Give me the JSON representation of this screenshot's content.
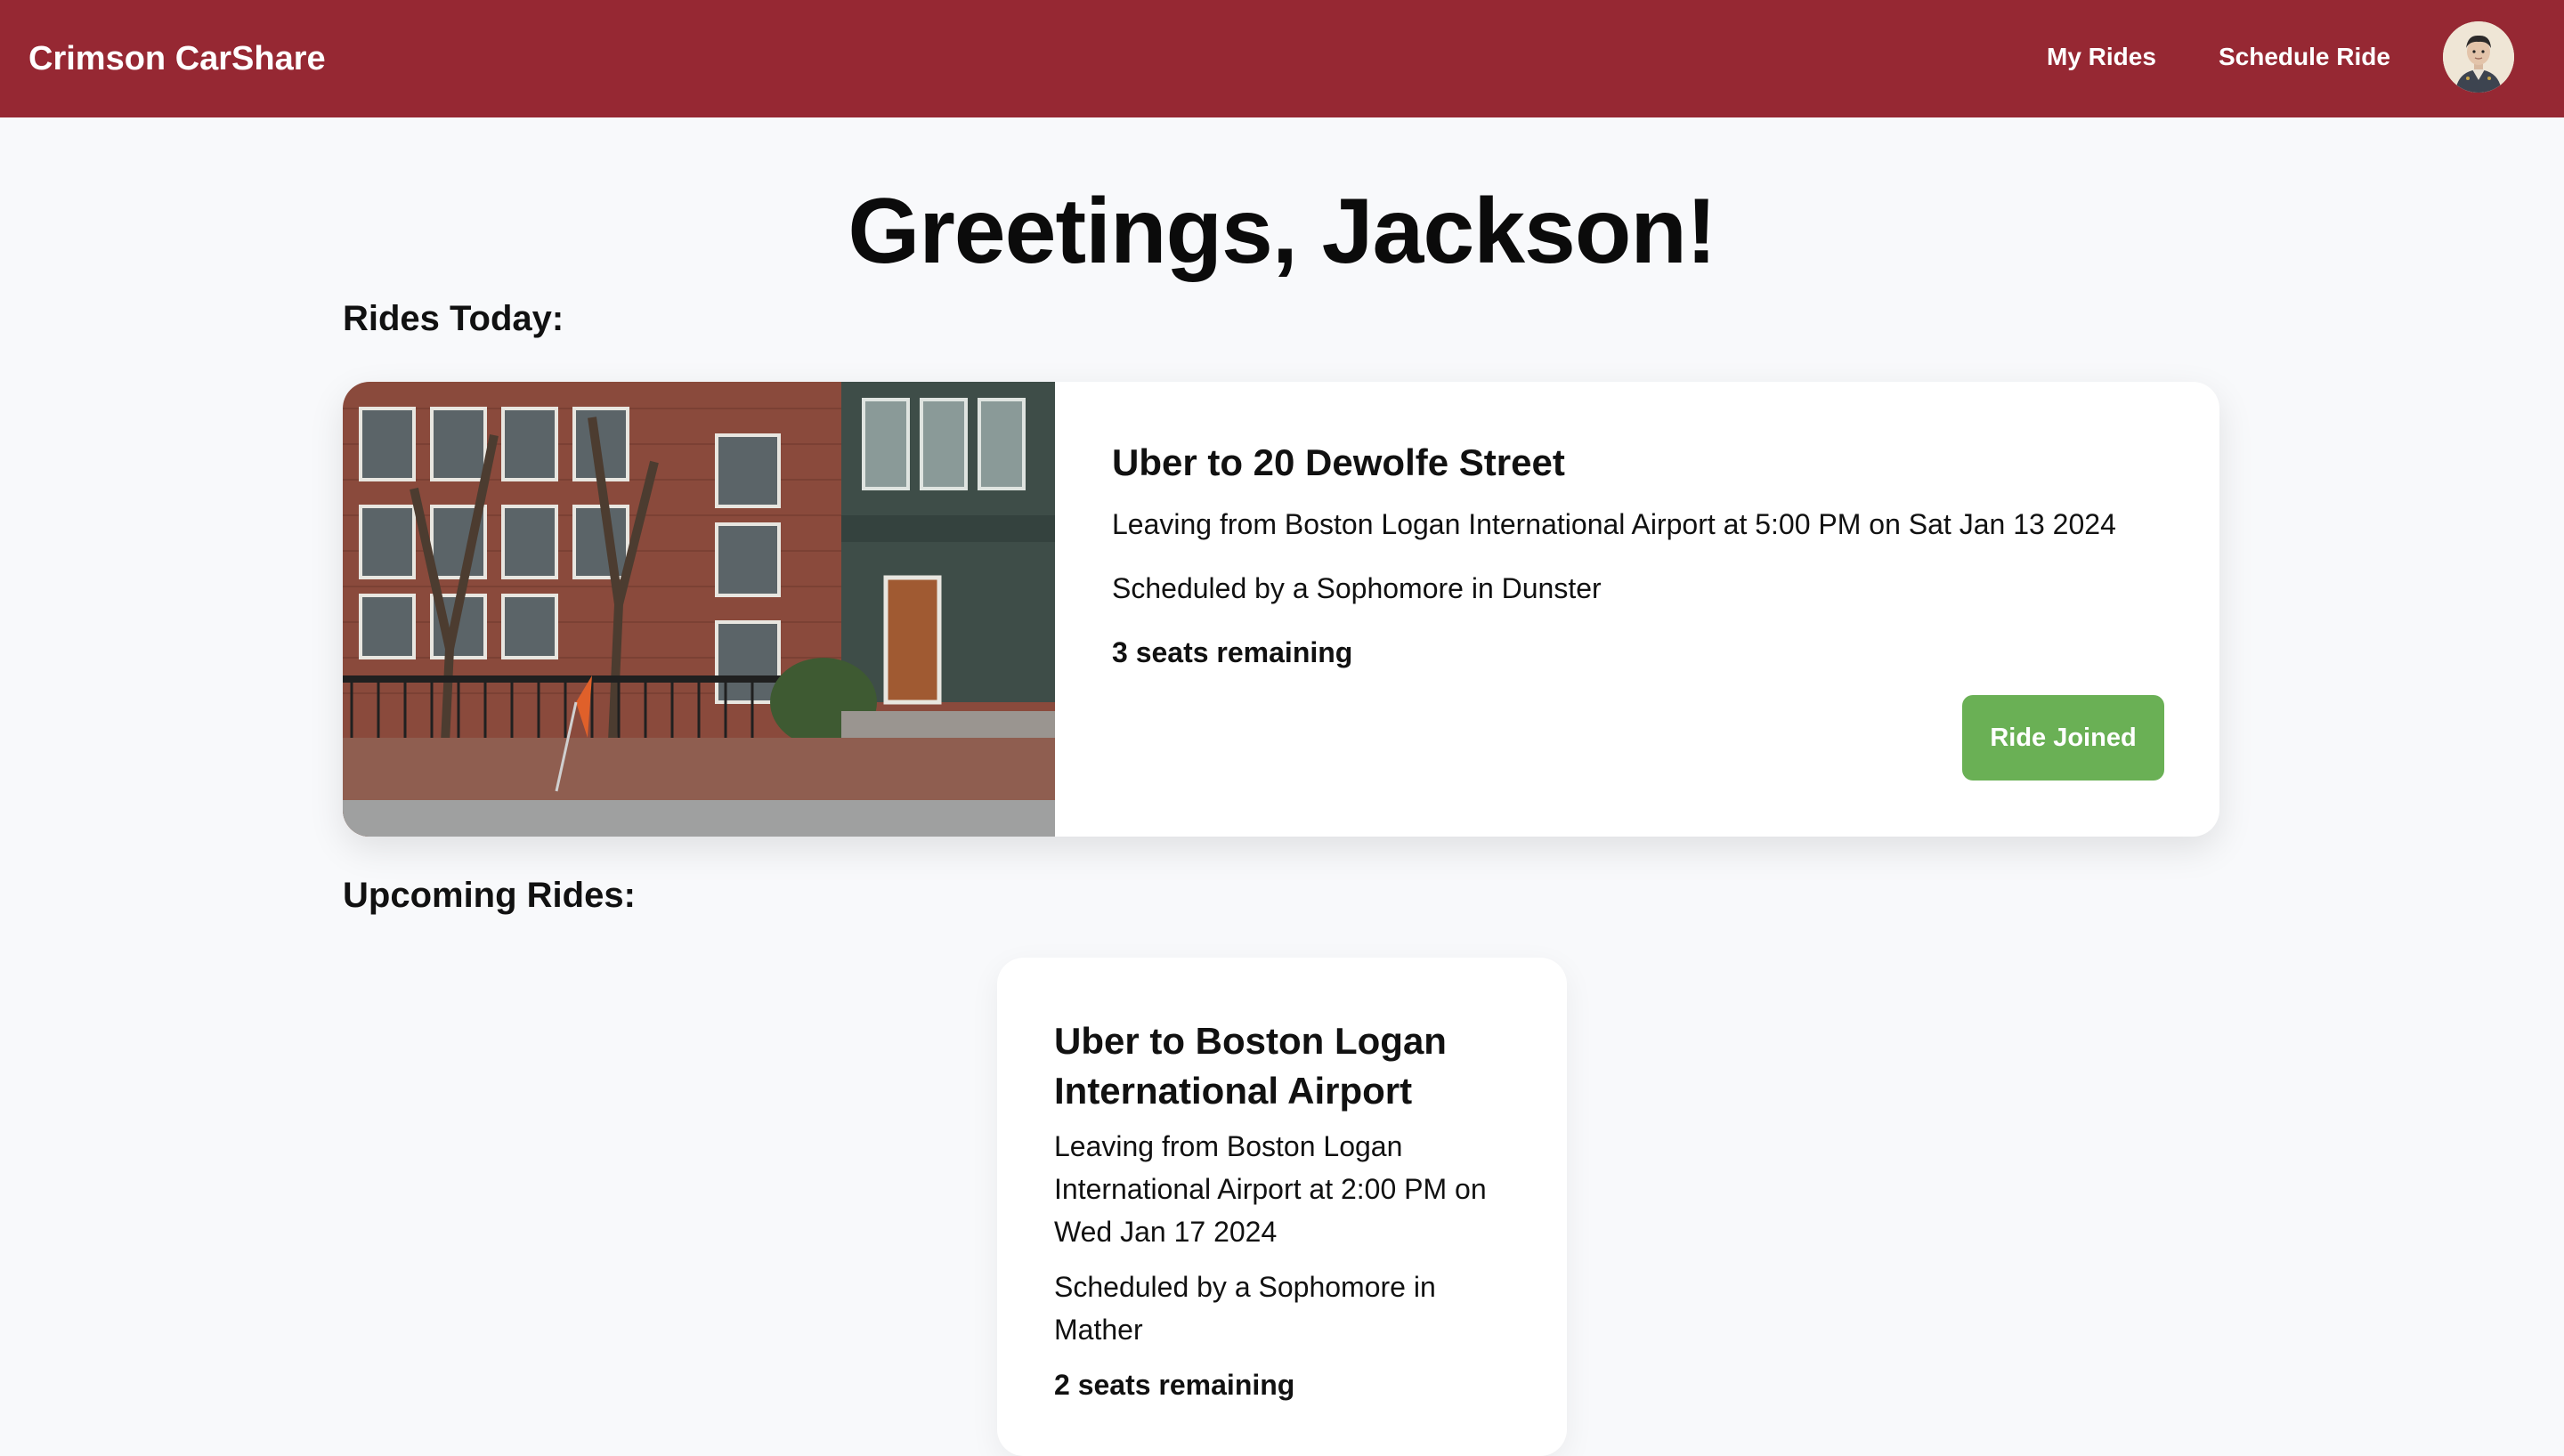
{
  "navbar": {
    "brand": "Crimson CarShare",
    "links": [
      "My Rides",
      "Schedule Ride"
    ],
    "background_color": "#962833",
    "avatar_icon": "user-avatar-icon"
  },
  "greeting": "Greetings, Jackson!",
  "sections": {
    "today_heading": "Rides Today:",
    "upcoming_heading": "Upcoming Rides:"
  },
  "rides_today": [
    {
      "title": "Uber to 20 Dewolfe Street",
      "leaving": "Leaving from Boston Logan International Airport at 5:00 PM on Sat Jan 13 2024",
      "scheduled_by": "Scheduled by a Sophomore in Dunster",
      "seats": "3 seats remaining",
      "button_label": "Ride Joined",
      "button_color": "#6ab055",
      "image_icon": "brick-building-photo"
    }
  ],
  "upcoming_rides": [
    {
      "title": "Uber to Boston Logan International Airport",
      "leaving": "Leaving from Boston Logan International Airport at 2:00 PM on Wed Jan 17 2024",
      "scheduled_by": "Scheduled by a Sophomore in Mather",
      "seats": "2 seats remaining"
    }
  ]
}
